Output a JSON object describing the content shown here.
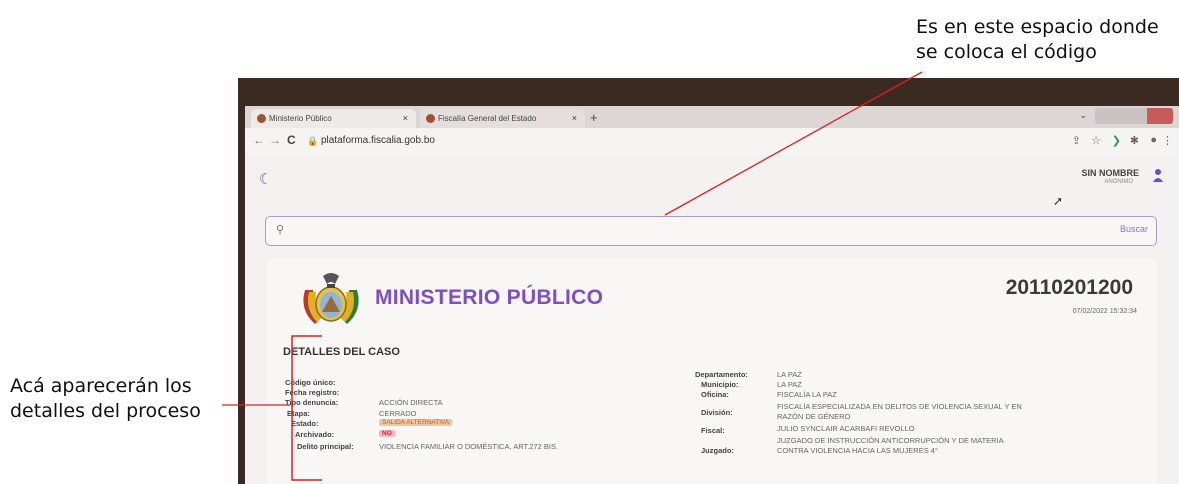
{
  "annotations": {
    "top": [
      "Es en este espacio donde",
      "se coloca el código"
    ],
    "left": [
      "Acá aparecerán los",
      "detalles del proceso"
    ],
    "line_color": "#e02020"
  },
  "browser": {
    "tabs": [
      {
        "label": "Ministerio Público",
        "close": "×"
      },
      {
        "label": "Fiscalía General del Estado",
        "close": "×"
      }
    ],
    "new_tab": "+",
    "url": "plataforma.fiscalia.gob.bo"
  },
  "header": {
    "user_name": "SIN NOMBRE",
    "user_sub": "ANONIMO"
  },
  "search": {
    "placeholder": "",
    "button": "Buscar"
  },
  "case": {
    "org_name": "MINISTERIO PÚBLICO",
    "number": "20110201200",
    "datetime": "07/02/2022 15:32:34",
    "section_title": "DETALLES DEL CASO",
    "left_fields": [
      {
        "label": "Código único:",
        "value": ""
      },
      {
        "label": "Fecha registro:",
        "value": ""
      },
      {
        "label": "Tipo denuncia:",
        "value": "ACCIÓN DIRECTA"
      },
      {
        "label": "Etapa:",
        "value": "CERRADO"
      },
      {
        "label": "Estado:",
        "value": "SALIDA ALTERNATIVA"
      },
      {
        "label": "Archivado:",
        "value": "NO"
      },
      {
        "label": "Delito principal:",
        "value": "VIOLENCIA FAMILIAR O DOMÉSTICA, ART.272 BIS."
      }
    ],
    "right_fields": [
      {
        "label": "Departamento:",
        "value": "LA PAZ"
      },
      {
        "label": "Municipio:",
        "value": "LA PAZ"
      },
      {
        "label": "Oficina:",
        "value": "FISCALÍA LA PAZ"
      },
      {
        "label": "División:",
        "value": [
          "FISCALÍA ESPECIALIZADA EN DELITOS DE VIOLENCIA SEXUAL Y EN",
          "RAZÓN DE GÉNERO"
        ]
      },
      {
        "label": "Fiscal:",
        "value": "JULIO SYNCLAIR ACARBAFI REVOLLO"
      },
      {
        "label": "Juzgado:",
        "value": [
          "JUZGADO DE INSTRUCCIÓN ANTICORRUPCIÓN Y DE MATERIA",
          "CONTRA VIOLENCIA HACIA LAS MUJERES 4°"
        ]
      }
    ],
    "accent_color": "#7c4fc9",
    "estado_badge_color": "#f0c6a0",
    "archivado_badge_color": "#f2b8b8"
  }
}
